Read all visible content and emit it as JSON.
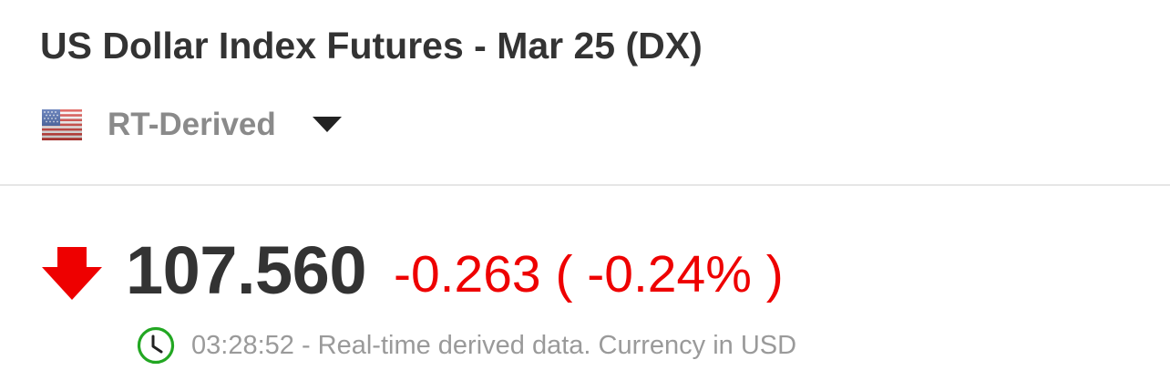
{
  "instrument": {
    "title": "US Dollar Index Futures - Mar 25 (DX)"
  },
  "source_selector": {
    "flag_icon": "us-flag-icon",
    "label": "RT-Derived",
    "caret_icon": "caret-down-icon"
  },
  "quote": {
    "direction_icon": "down-arrow-icon",
    "direction": "down",
    "last": "107.560",
    "change_text": "-0.263 ( -0.24% )",
    "change_color": "#ee0000"
  },
  "timestamp": {
    "clock_icon": "clock-icon",
    "clock_color": "#22a722",
    "text": "03:28:52 - Real-time derived data. Currency in USD"
  }
}
